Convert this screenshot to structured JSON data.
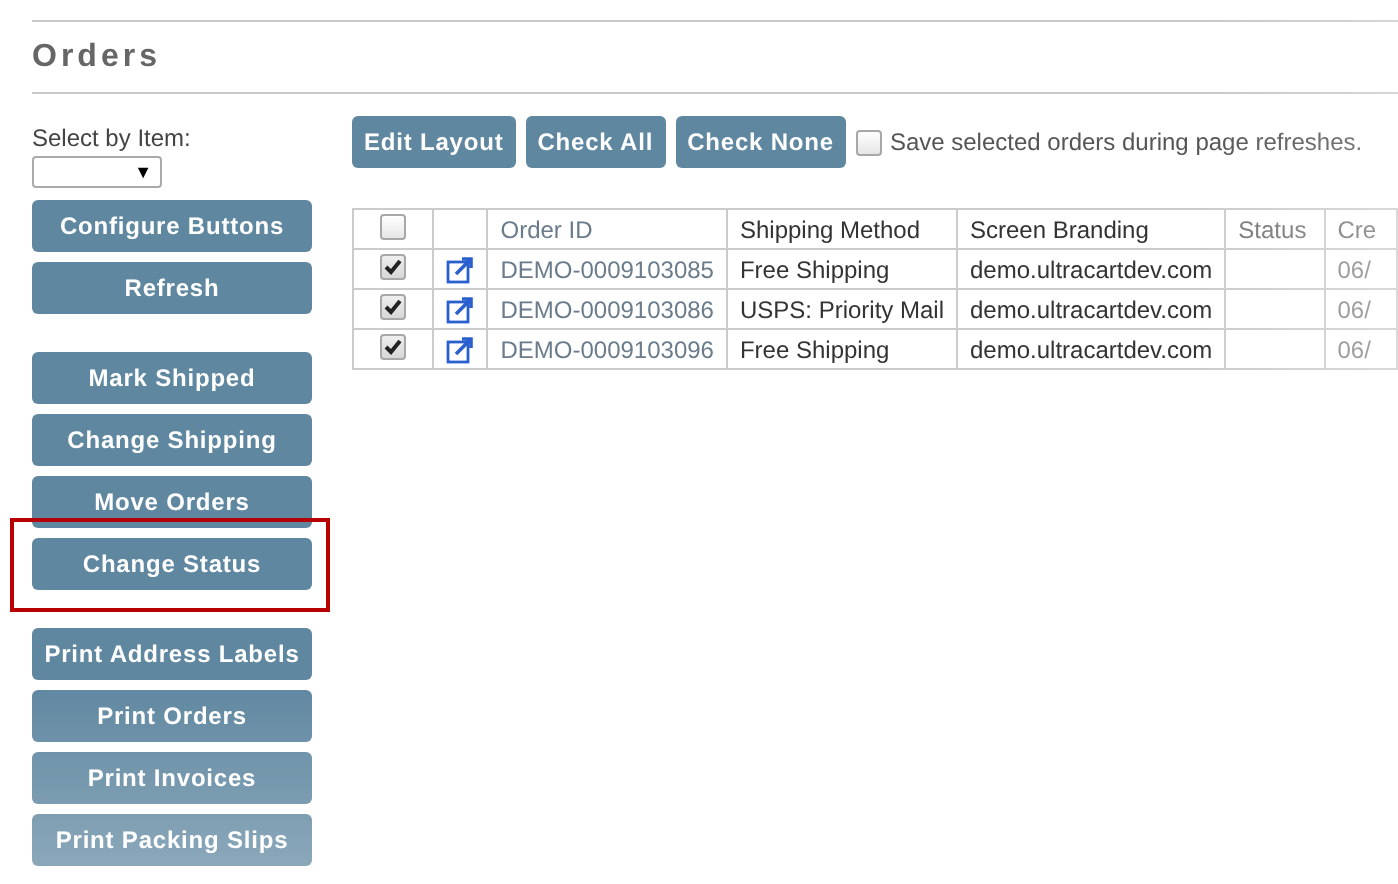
{
  "page": {
    "title": "Orders"
  },
  "select_by_item": {
    "label": "Select by Item:",
    "caret": "▼"
  },
  "button_groups": [
    [
      {
        "label": "Configure Buttons",
        "highlighted": false
      },
      {
        "label": "Refresh",
        "highlighted": false
      }
    ],
    [
      {
        "label": "Mark Shipped",
        "highlighted": false
      },
      {
        "label": "Change Shipping",
        "highlighted": false
      },
      {
        "label": "Move Orders",
        "highlighted": false
      },
      {
        "label": "Change Status",
        "highlighted": true
      }
    ],
    [
      {
        "label": "Print Address Labels",
        "highlighted": false
      },
      {
        "label": "Print Orders",
        "highlighted": false
      },
      {
        "label": "Print Invoices",
        "highlighted": false
      },
      {
        "label": "Print Packing Slips",
        "highlighted": false
      }
    ]
  ],
  "toolbar": {
    "buttons": [
      "Edit Layout",
      "Check All",
      "Check None"
    ],
    "save_selected": {
      "label": "Save selected orders during page refreshes.",
      "checked": false
    }
  },
  "table": {
    "select_all": {
      "checked": false
    },
    "columns": [
      "Order ID",
      "Shipping Method",
      "Screen Branding",
      "Status",
      "Cre"
    ],
    "rows": [
      {
        "selected": true,
        "order_id": "DEMO-0009103085",
        "shipping_method": "Free Shipping",
        "screen_branding": "demo.ultracartdev.com",
        "column_7": "06/"
      },
      {
        "selected": true,
        "order_id": "DEMO-0009103086",
        "shipping_method": "USPS: Priority Mail",
        "screen_branding": "demo.ultracartdev.com",
        "column_7": "06/"
      },
      {
        "selected": true,
        "order_id": "DEMO-0009103096",
        "shipping_method": "Free Shipping",
        "screen_branding": "demo.ultracartdev.com",
        "column_7": "06/"
      }
    ]
  }
}
